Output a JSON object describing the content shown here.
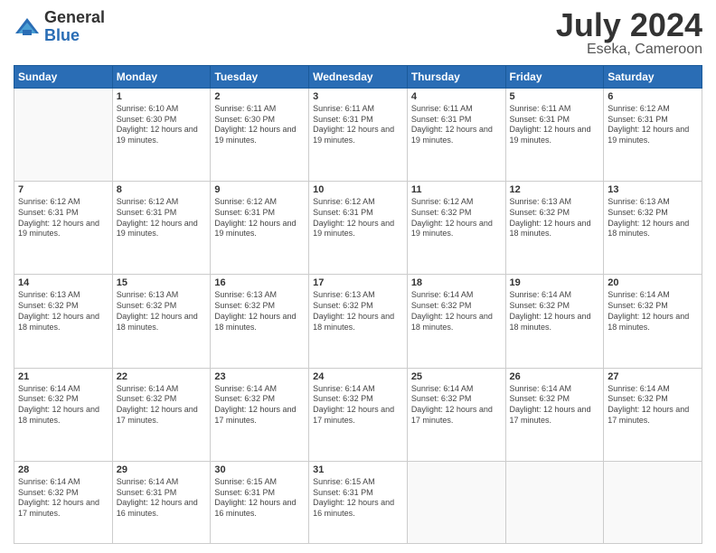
{
  "header": {
    "logo_general": "General",
    "logo_blue": "Blue",
    "title": "July 2024",
    "location": "Eseka, Cameroon"
  },
  "weekdays": [
    "Sunday",
    "Monday",
    "Tuesday",
    "Wednesday",
    "Thursday",
    "Friday",
    "Saturday"
  ],
  "weeks": [
    [
      {
        "day": "",
        "info": ""
      },
      {
        "day": "1",
        "info": "Sunrise: 6:10 AM\nSunset: 6:30 PM\nDaylight: 12 hours\nand 19 minutes."
      },
      {
        "day": "2",
        "info": "Sunrise: 6:11 AM\nSunset: 6:30 PM\nDaylight: 12 hours\nand 19 minutes."
      },
      {
        "day": "3",
        "info": "Sunrise: 6:11 AM\nSunset: 6:31 PM\nDaylight: 12 hours\nand 19 minutes."
      },
      {
        "day": "4",
        "info": "Sunrise: 6:11 AM\nSunset: 6:31 PM\nDaylight: 12 hours\nand 19 minutes."
      },
      {
        "day": "5",
        "info": "Sunrise: 6:11 AM\nSunset: 6:31 PM\nDaylight: 12 hours\nand 19 minutes."
      },
      {
        "day": "6",
        "info": "Sunrise: 6:12 AM\nSunset: 6:31 PM\nDaylight: 12 hours\nand 19 minutes."
      }
    ],
    [
      {
        "day": "7",
        "info": "Sunrise: 6:12 AM\nSunset: 6:31 PM\nDaylight: 12 hours\nand 19 minutes."
      },
      {
        "day": "8",
        "info": "Sunrise: 6:12 AM\nSunset: 6:31 PM\nDaylight: 12 hours\nand 19 minutes."
      },
      {
        "day": "9",
        "info": "Sunrise: 6:12 AM\nSunset: 6:31 PM\nDaylight: 12 hours\nand 19 minutes."
      },
      {
        "day": "10",
        "info": "Sunrise: 6:12 AM\nSunset: 6:31 PM\nDaylight: 12 hours\nand 19 minutes."
      },
      {
        "day": "11",
        "info": "Sunrise: 6:12 AM\nSunset: 6:32 PM\nDaylight: 12 hours\nand 19 minutes."
      },
      {
        "day": "12",
        "info": "Sunrise: 6:13 AM\nSunset: 6:32 PM\nDaylight: 12 hours\nand 18 minutes."
      },
      {
        "day": "13",
        "info": "Sunrise: 6:13 AM\nSunset: 6:32 PM\nDaylight: 12 hours\nand 18 minutes."
      }
    ],
    [
      {
        "day": "14",
        "info": "Sunrise: 6:13 AM\nSunset: 6:32 PM\nDaylight: 12 hours\nand 18 minutes."
      },
      {
        "day": "15",
        "info": "Sunrise: 6:13 AM\nSunset: 6:32 PM\nDaylight: 12 hours\nand 18 minutes."
      },
      {
        "day": "16",
        "info": "Sunrise: 6:13 AM\nSunset: 6:32 PM\nDaylight: 12 hours\nand 18 minutes."
      },
      {
        "day": "17",
        "info": "Sunrise: 6:13 AM\nSunset: 6:32 PM\nDaylight: 12 hours\nand 18 minutes."
      },
      {
        "day": "18",
        "info": "Sunrise: 6:14 AM\nSunset: 6:32 PM\nDaylight: 12 hours\nand 18 minutes."
      },
      {
        "day": "19",
        "info": "Sunrise: 6:14 AM\nSunset: 6:32 PM\nDaylight: 12 hours\nand 18 minutes."
      },
      {
        "day": "20",
        "info": "Sunrise: 6:14 AM\nSunset: 6:32 PM\nDaylight: 12 hours\nand 18 minutes."
      }
    ],
    [
      {
        "day": "21",
        "info": "Sunrise: 6:14 AM\nSunset: 6:32 PM\nDaylight: 12 hours\nand 18 minutes."
      },
      {
        "day": "22",
        "info": "Sunrise: 6:14 AM\nSunset: 6:32 PM\nDaylight: 12 hours\nand 17 minutes."
      },
      {
        "day": "23",
        "info": "Sunrise: 6:14 AM\nSunset: 6:32 PM\nDaylight: 12 hours\nand 17 minutes."
      },
      {
        "day": "24",
        "info": "Sunrise: 6:14 AM\nSunset: 6:32 PM\nDaylight: 12 hours\nand 17 minutes."
      },
      {
        "day": "25",
        "info": "Sunrise: 6:14 AM\nSunset: 6:32 PM\nDaylight: 12 hours\nand 17 minutes."
      },
      {
        "day": "26",
        "info": "Sunrise: 6:14 AM\nSunset: 6:32 PM\nDaylight: 12 hours\nand 17 minutes."
      },
      {
        "day": "27",
        "info": "Sunrise: 6:14 AM\nSunset: 6:32 PM\nDaylight: 12 hours\nand 17 minutes."
      }
    ],
    [
      {
        "day": "28",
        "info": "Sunrise: 6:14 AM\nSunset: 6:32 PM\nDaylight: 12 hours\nand 17 minutes."
      },
      {
        "day": "29",
        "info": "Sunrise: 6:14 AM\nSunset: 6:31 PM\nDaylight: 12 hours\nand 16 minutes."
      },
      {
        "day": "30",
        "info": "Sunrise: 6:15 AM\nSunset: 6:31 PM\nDaylight: 12 hours\nand 16 minutes."
      },
      {
        "day": "31",
        "info": "Sunrise: 6:15 AM\nSunset: 6:31 PM\nDaylight: 12 hours\nand 16 minutes."
      },
      {
        "day": "",
        "info": ""
      },
      {
        "day": "",
        "info": ""
      },
      {
        "day": "",
        "info": ""
      }
    ]
  ]
}
